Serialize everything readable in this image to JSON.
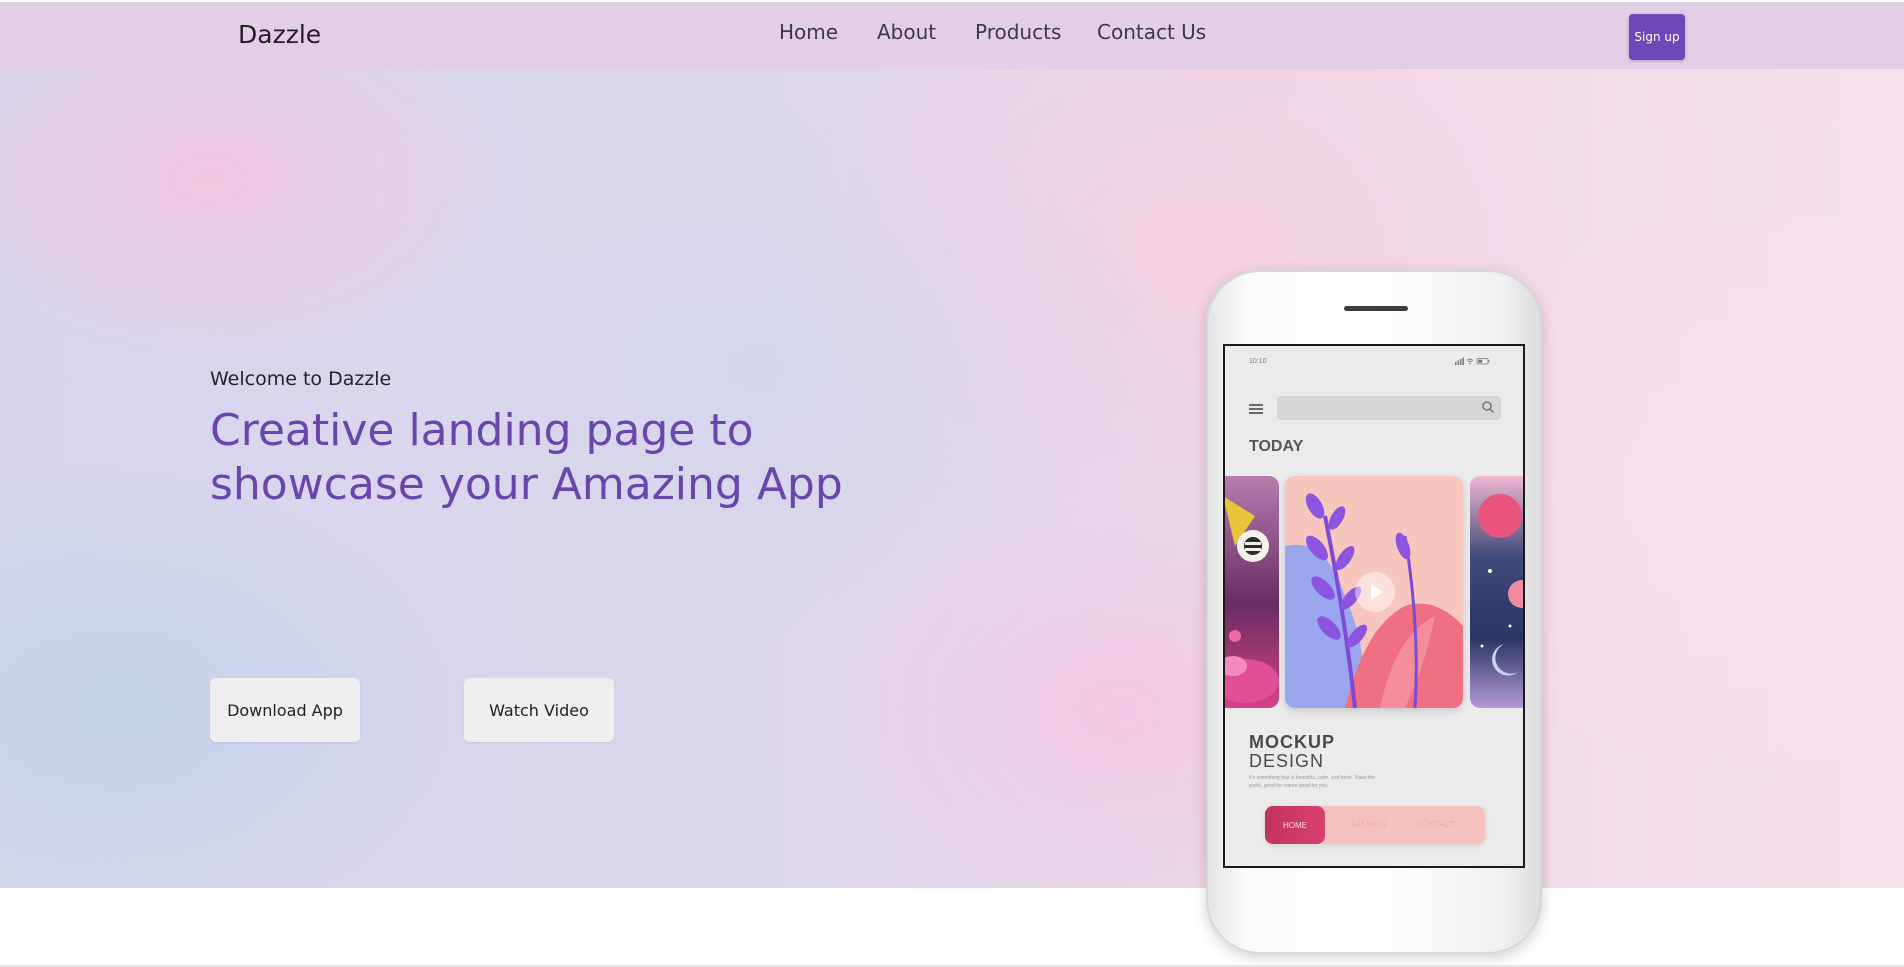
{
  "navbar": {
    "brand": "Dazzle",
    "links": [
      "Home",
      "About",
      "Products",
      "Contact Us"
    ],
    "signup_label": "Sign up"
  },
  "hero": {
    "welcome": "Welcome to Dazzle",
    "headline": "Creative landing page to showcase your Amazing App",
    "buttons": [
      "Download App",
      "Watch Video"
    ]
  },
  "phone": {
    "status_time": "10:10",
    "section_title": "TODAY",
    "mockup_title": "MOCKUP",
    "mockup_subtitle": "DESIGN",
    "mockup_description": "It's something that is beautiful, calm, and fresh. Make the world, good for nature good for you.",
    "nav_items": [
      "HOME",
      "FASHION",
      "CONTACT"
    ]
  },
  "colors": {
    "accent": "#6f47b7",
    "headline": "#6a45ad",
    "navbar_bg": "#e3cde7"
  }
}
